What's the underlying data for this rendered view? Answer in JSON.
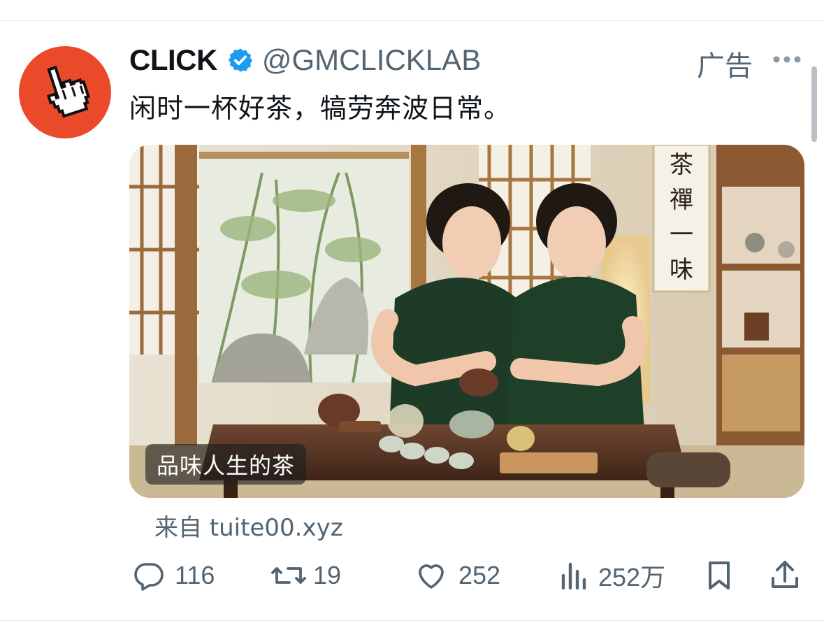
{
  "tweet": {
    "author_name": "CLICK",
    "author_handle": "@GMCLICKLAB",
    "ad_label": "广告",
    "text": "闲时一杯好茶，犒劳奔波日常。",
    "media_caption": "品味人生的茶",
    "scroll_painting_text": "茶禪一味",
    "source": "来自 tuite00.xyz"
  },
  "actions": {
    "replies": "116",
    "retweets": "19",
    "likes": "252",
    "views": "252万"
  },
  "icons": {
    "avatar": "pointing-hand-cursor-icon",
    "verified": "verified-badge-icon",
    "more": "more-dots-icon",
    "reply": "reply-icon",
    "retweet": "retweet-icon",
    "like": "heart-icon",
    "views": "views-chart-icon",
    "bookmark": "bookmark-icon",
    "share": "share-icon"
  },
  "colors": {
    "avatar_bg": "#ea4a2a",
    "verified": "#1d9bf0",
    "secondary_text": "#536471",
    "primary_text": "#0f1419"
  }
}
